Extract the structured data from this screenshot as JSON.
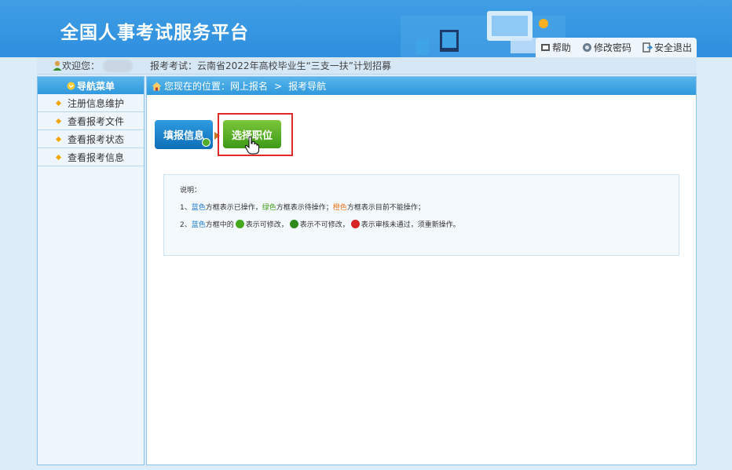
{
  "header": {
    "title": "全国人事考试服务平台",
    "links": [
      {
        "label": "帮助",
        "icon": "help-icon"
      },
      {
        "label": "修改密码",
        "icon": "key-icon"
      },
      {
        "label": "安全退出",
        "icon": "logout-icon"
      }
    ]
  },
  "welcome": {
    "greeting": "欢迎您：",
    "exam_prefix": "报考考试：",
    "exam_name": "云南省2022年高校毕业生“三支一扶”计划招募"
  },
  "sidebar": {
    "title": "导航菜单",
    "items": [
      {
        "label": "注册信息维护"
      },
      {
        "label": "查看报考文件"
      },
      {
        "label": "查看报考状态"
      },
      {
        "label": "查看报考信息"
      }
    ]
  },
  "breadcrumb": {
    "prefix": "您现在的位置：",
    "level1": "网上报名",
    "sep": ">",
    "level2": "报考导航"
  },
  "steps": {
    "step1": "填报信息",
    "step2": "选择职位"
  },
  "note": {
    "title": "说明：",
    "l1_num": "1、",
    "l1_blue": "蓝色",
    "l1_a": "方框表示已操作，",
    "l1_green": "绿色",
    "l1_b": "方框表示待操作；",
    "l1_orange": "橙色",
    "l1_c": "方框表示目前不能操作；",
    "l2_num": "2、",
    "l2_blue": "蓝色",
    "l2_a": "方框中的",
    "l2_b": "表示可修改，",
    "l2_c": "表示不可修改，",
    "l2_d": "表示审核未通过，须重新操作。"
  },
  "colors": {
    "header": "#2f8fde",
    "step_done": "#0d6fb8",
    "step_pending": "#3d9a17",
    "highlight": "#e02a2a"
  }
}
